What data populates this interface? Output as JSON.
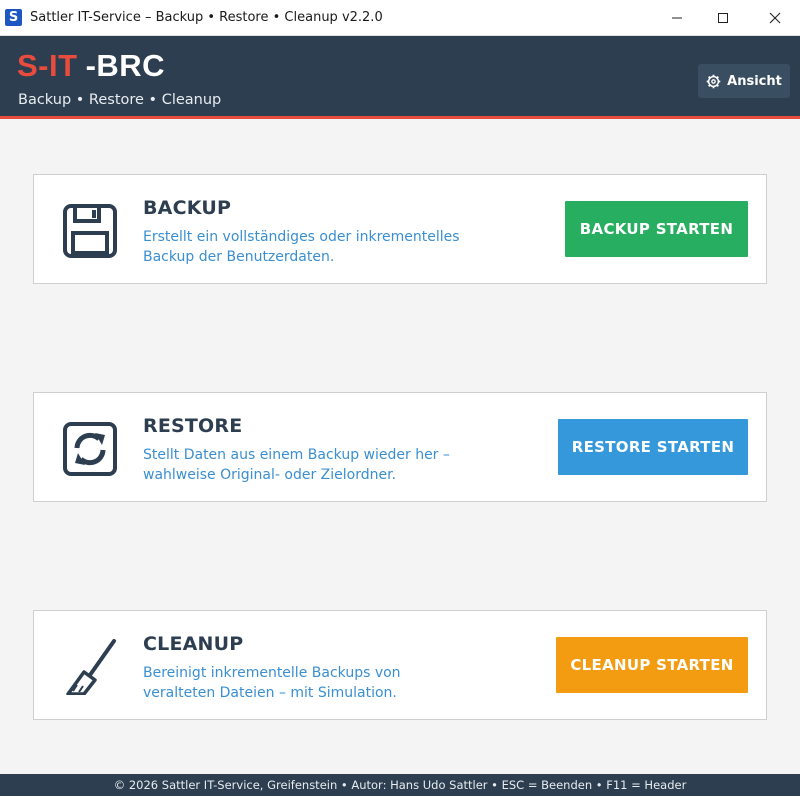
{
  "window": {
    "title": "Sattler IT-Service  –  Backup • Restore • Cleanup  v2.2.0",
    "app_icon_letter": "S"
  },
  "header": {
    "brand_red": "S-IT",
    "brand_white": "-BRC",
    "subtitle": "Backup  •  Restore  •  Cleanup",
    "view_button": "Ansicht",
    "accent_color": "#e74c3c",
    "background_color": "#2c3e50"
  },
  "cards": [
    {
      "title": "BACKUP",
      "description": "Erstellt ein vollständiges oder inkrementelles Backup der Benutzerdaten.",
      "button": "BACKUP STARTEN",
      "button_color": "#27ae60",
      "icon": "floppy-disk-icon"
    },
    {
      "title": "RESTORE",
      "description": "Stellt Daten aus einem Backup wieder her – wahlweise Original- oder Zielordner.",
      "button": "RESTORE STARTEN",
      "button_color": "#3498db",
      "icon": "restore-icon"
    },
    {
      "title": "CLEANUP",
      "description": "Bereinigt inkrementelle Backups von veralteten Dateien – mit Simulation.",
      "button": "CLEANUP STARTEN",
      "button_color": "#f39c12",
      "icon": "broom-icon"
    }
  ],
  "footer": {
    "text": "© 2026 Sattler IT-Service, Greifenstein  •  Autor: Hans Udo Sattler  •  ESC = Beenden  •  F11 = Header"
  }
}
